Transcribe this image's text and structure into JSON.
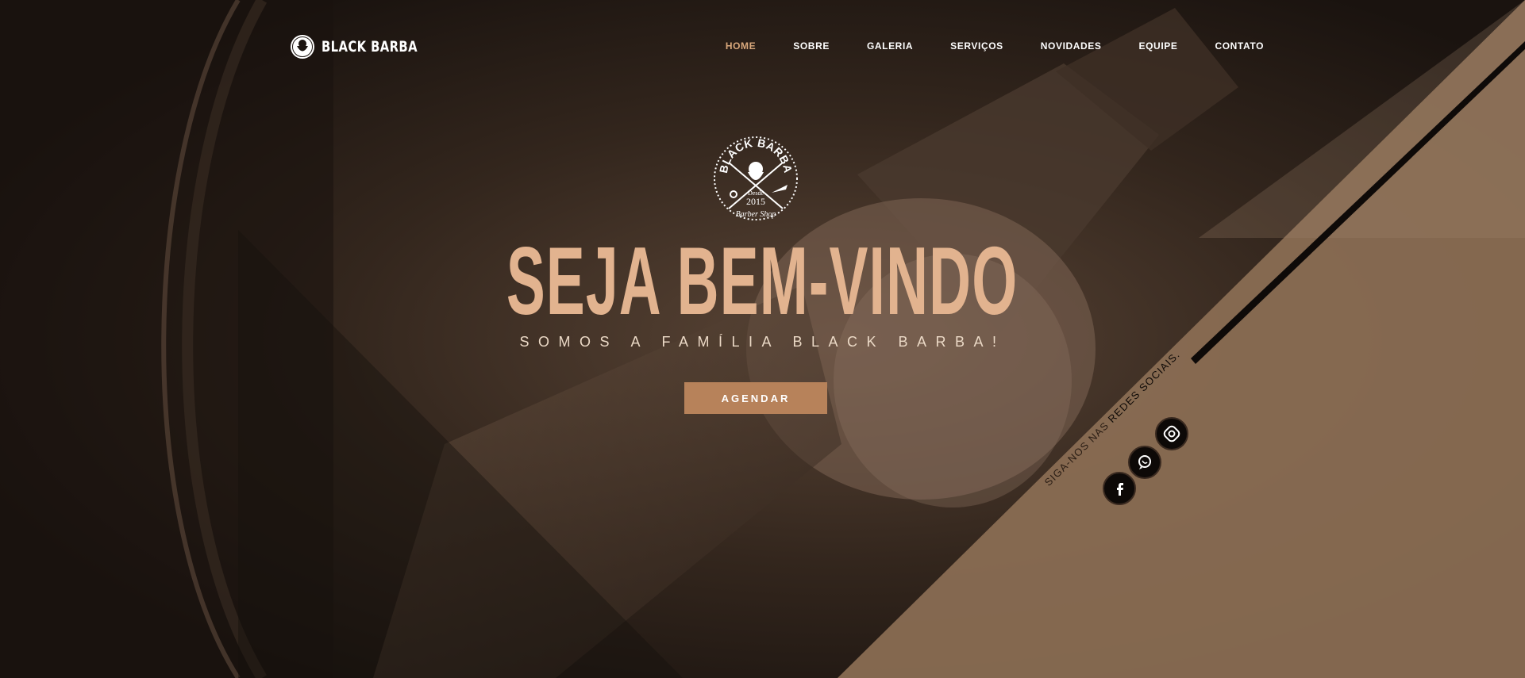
{
  "colors": {
    "background": "#1c1511",
    "accent": "#e2b38f",
    "nav_active": "#d9a87c",
    "button": "#b7825a",
    "diagonal_panel": "#8c6f55"
  },
  "brand": {
    "name": "BLACK BARBA",
    "logo_icon": "bearded-man-badge-icon"
  },
  "nav": {
    "items": [
      {
        "label": "HOME",
        "active": true
      },
      {
        "label": "SOBRE",
        "active": false
      },
      {
        "label": "GALERIA",
        "active": false
      },
      {
        "label": "SERVIÇOS",
        "active": false
      },
      {
        "label": "NOVIDADES",
        "active": false
      },
      {
        "label": "EQUIPE",
        "active": false
      },
      {
        "label": "CONTATO",
        "active": false
      }
    ]
  },
  "emblem": {
    "top_text": "BLACK BARBA",
    "since": "Desde",
    "year": "2015",
    "bottom_text": "Barber Shop"
  },
  "hero": {
    "title": "SEJA BEM-VINDO",
    "subtitle": "SOMOS A FAMÍLIA BLACK BARBA!",
    "cta_label": "AGENDAR"
  },
  "social": {
    "prefix": "SIGA-NOS NAS ",
    "highlight": "REDES SOCIAIS.",
    "icons": [
      "facebook-icon",
      "whatsapp-icon",
      "instagram-icon"
    ]
  }
}
